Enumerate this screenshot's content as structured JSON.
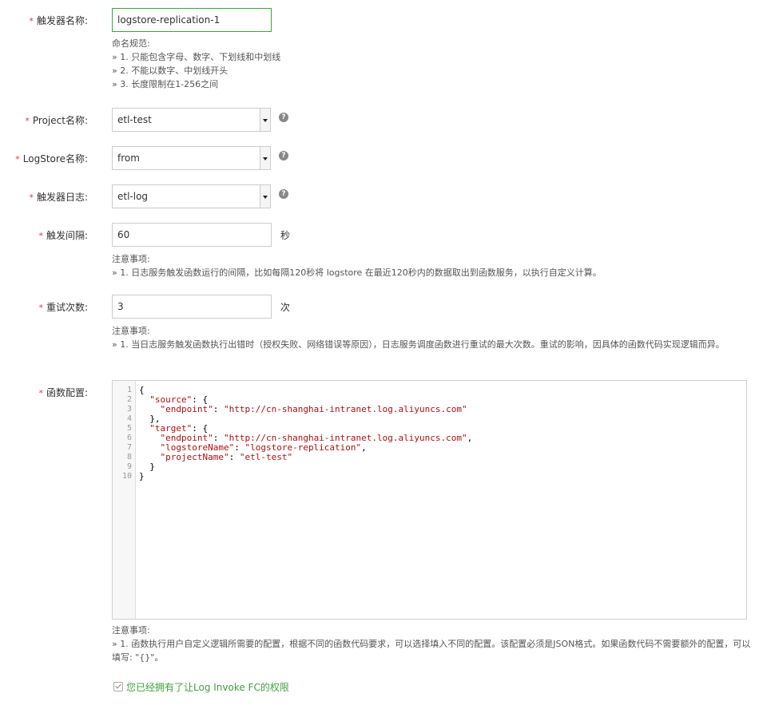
{
  "fields": {
    "trigger_name": {
      "label": "触发器名称:",
      "value": "logstore-replication-1",
      "note_title": "命名规范:",
      "notes": [
        "» 1. 只能包含字母、数字、下划线和中划线",
        "» 2. 不能以数字、中划线开头",
        "» 3. 长度限制在1-256之间"
      ]
    },
    "project": {
      "label": "Project名称:",
      "value": "etl-test"
    },
    "logstore": {
      "label": "LogStore名称:",
      "value": "from"
    },
    "trigger_log": {
      "label": "触发器日志:",
      "value": "etl-log"
    },
    "interval": {
      "label": "触发间隔:",
      "value": "60",
      "unit": "秒",
      "note_title": "注意事项:",
      "notes": [
        "» 1. 日志服务触发函数运行的间隔，比如每隔120秒将 logstore 在最近120秒内的数据取出到函数服务，以执行自定义计算。"
      ]
    },
    "retries": {
      "label": "重试次数:",
      "value": "3",
      "unit": "次",
      "note_title": "注意事项:",
      "notes": [
        "» 1. 当日志服务触发函数执行出错时（授权失败、网络错误等原因），日志服务调度函数进行重试的最大次数。重试的影响，因具体的函数代码实现逻辑而异。"
      ]
    },
    "function_config": {
      "label": "函数配置:",
      "line_numbers": [
        "1",
        "2",
        "3",
        "4",
        "5",
        "6",
        "7",
        "8",
        "9",
        "10"
      ],
      "code_lines": [
        "{",
        "  \"source\": {",
        "    \"endpoint\": \"http://cn-shanghai-intranet.log.aliyuncs.com\"",
        "  },",
        "  \"target\": {",
        "    \"endpoint\": \"http://cn-shanghai-intranet.log.aliyuncs.com\",",
        "    \"logstoreName\": \"logstore-replication\",",
        "    \"projectName\": \"etl-test\"",
        "  }",
        "}"
      ],
      "note_title": "注意事项:",
      "notes": [
        "» 1. 函数执行用户自定义逻辑所需要的配置，根据不同的函数代码要求，可以选择填入不同的配置。该配置必须是JSON格式。如果函数代码不需要额外的配置，可以填写: \"{}\"。"
      ]
    }
  },
  "permission": {
    "text": "您已经拥有了让Log Invoke FC的权限",
    "checked": true
  },
  "required_mark": "*",
  "help_glyph": "?",
  "colors": {
    "accent": "#3ea23e",
    "required": "#e4393c",
    "json_string": "#a11"
  }
}
